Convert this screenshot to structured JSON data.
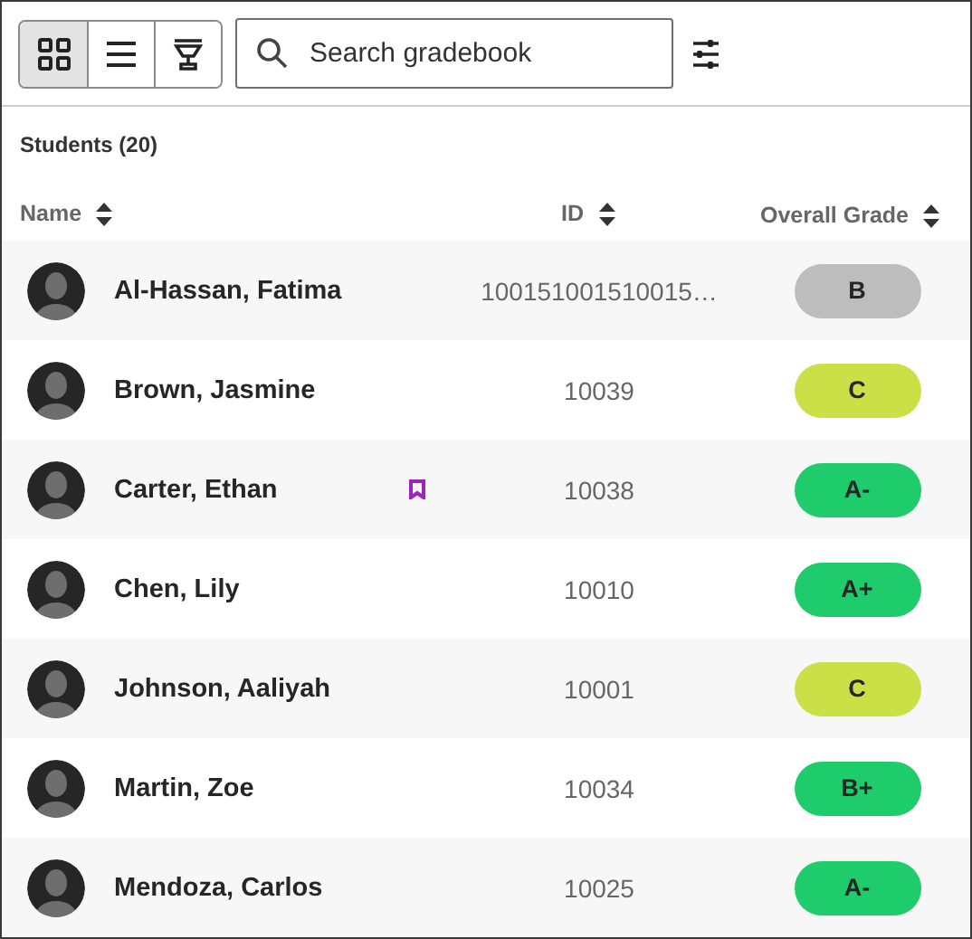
{
  "toolbar": {
    "views": [
      {
        "kind": "grid",
        "selected": true
      },
      {
        "kind": "list",
        "selected": false
      },
      {
        "kind": "trophy",
        "selected": false
      }
    ],
    "search": {
      "placeholder": "Search gradebook"
    }
  },
  "section_title": "Students (20)",
  "table": {
    "columns": [
      "Name",
      "ID",
      "Overall Grade"
    ],
    "rows": [
      {
        "name": "Al-Hassan, Fatima",
        "flagged": false,
        "id": "100151001510015…",
        "grade": "B",
        "color": "#bdbdbd"
      },
      {
        "name": "Brown, Jasmine",
        "flagged": false,
        "id": "10039",
        "grade": "C",
        "color": "#cbe046"
      },
      {
        "name": "Carter, Ethan",
        "flagged": true,
        "id": "10038",
        "grade": "A-",
        "color": "#1fcc6b"
      },
      {
        "name": "Chen, Lily",
        "flagged": false,
        "id": "10010",
        "grade": "A+",
        "color": "#1fcc6b"
      },
      {
        "name": "Johnson, Aaliyah",
        "flagged": false,
        "id": "10001",
        "grade": "C",
        "color": "#cbe046"
      },
      {
        "name": "Martin, Zoe",
        "flagged": false,
        "id": "10034",
        "grade": "B+",
        "color": "#1fcc6b"
      },
      {
        "name": "Mendoza, Carlos",
        "flagged": false,
        "id": "10025",
        "grade": "A-",
        "color": "#1fcc6b"
      }
    ]
  }
}
